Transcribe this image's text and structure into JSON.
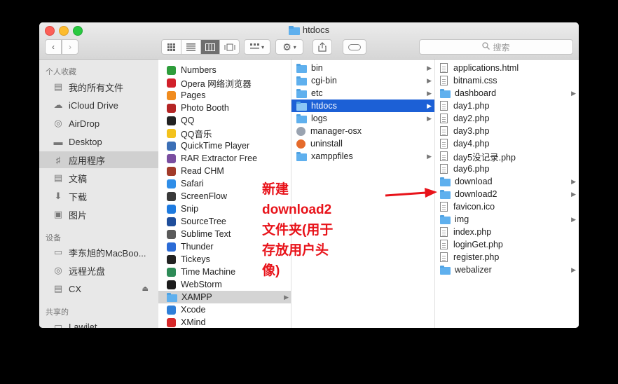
{
  "window": {
    "title": "htdocs",
    "search_placeholder": "搜索"
  },
  "sidebar": {
    "favorites_header": "个人收藏",
    "favorites": [
      {
        "label": "我的所有文件",
        "icon": "all-files-icon"
      },
      {
        "label": "iCloud Drive",
        "icon": "cloud-icon"
      },
      {
        "label": "AirDrop",
        "icon": "airdrop-icon"
      },
      {
        "label": "Desktop",
        "icon": "desktop-icon"
      },
      {
        "label": "应用程序",
        "icon": "applications-icon",
        "selected": true
      },
      {
        "label": "文稿",
        "icon": "documents-icon"
      },
      {
        "label": "下载",
        "icon": "downloads-icon"
      },
      {
        "label": "图片",
        "icon": "pictures-icon"
      }
    ],
    "devices_header": "设备",
    "devices": [
      {
        "label": "李东旭的MacBoo...",
        "icon": "laptop-icon"
      },
      {
        "label": "远程光盘",
        "icon": "disc-icon"
      },
      {
        "label": "CX",
        "icon": "drive-icon"
      }
    ],
    "shared_header": "共享的",
    "shared": [
      {
        "label": "Lawilet",
        "icon": "network-icon"
      }
    ]
  },
  "column1": [
    {
      "label": "Numbers",
      "color": "#2e9d3b"
    },
    {
      "label": "Opera 网络浏览器",
      "color": "#d1202a"
    },
    {
      "label": "Pages",
      "color": "#f08b1e"
    },
    {
      "label": "Photo Booth",
      "color": "#b42525"
    },
    {
      "label": "QQ",
      "color": "#222222"
    },
    {
      "label": "QQ音乐",
      "color": "#f3c21c"
    },
    {
      "label": "QuickTime Player",
      "color": "#3b6fb6"
    },
    {
      "label": "RAR Extractor Free",
      "color": "#7a4ea0"
    },
    {
      "label": "Read CHM",
      "color": "#a23b2a"
    },
    {
      "label": "Safari",
      "color": "#2f8ee8"
    },
    {
      "label": "ScreenFlow",
      "color": "#3a3a3a"
    },
    {
      "label": "Snip",
      "color": "#1e7be0"
    },
    {
      "label": "SourceTree",
      "color": "#1f4e9b"
    },
    {
      "label": "Sublime Text",
      "color": "#5a5a5a"
    },
    {
      "label": "Thunder",
      "color": "#2b6bd6"
    },
    {
      "label": "Tickeys",
      "color": "#222222"
    },
    {
      "label": "Time Machine",
      "color": "#2e8b57"
    },
    {
      "label": "WebStorm",
      "color": "#1c1c1c"
    },
    {
      "label": "XAMPP",
      "color": "#5fb0ee",
      "folder": true,
      "selected": true
    },
    {
      "label": "Xcode",
      "color": "#2f7fd8"
    },
    {
      "label": "XMind",
      "color": "#d6282a"
    }
  ],
  "column2": [
    {
      "label": "bin",
      "type": "folder",
      "chevron": true
    },
    {
      "label": "cgi-bin",
      "type": "folder",
      "chevron": true
    },
    {
      "label": "etc",
      "type": "folder",
      "chevron": true
    },
    {
      "label": "htdocs",
      "type": "folder",
      "chevron": true,
      "selected": true
    },
    {
      "label": "logs",
      "type": "folder",
      "chevron": true
    },
    {
      "label": "manager-osx",
      "type": "app"
    },
    {
      "label": "uninstall",
      "type": "app"
    },
    {
      "label": "xamppfiles",
      "type": "folder",
      "chevron": true
    }
  ],
  "column3": [
    {
      "label": "applications.html",
      "type": "file"
    },
    {
      "label": "bitnami.css",
      "type": "file"
    },
    {
      "label": "dashboard",
      "type": "folder",
      "chevron": true
    },
    {
      "label": "day1.php",
      "type": "file"
    },
    {
      "label": "day2.php",
      "type": "file"
    },
    {
      "label": "day3.php",
      "type": "file"
    },
    {
      "label": "day4.php",
      "type": "file"
    },
    {
      "label": "day5没记录.php",
      "type": "file"
    },
    {
      "label": "day6.php",
      "type": "file"
    },
    {
      "label": "download",
      "type": "folder",
      "chevron": true
    },
    {
      "label": "download2",
      "type": "folder",
      "chevron": true
    },
    {
      "label": "favicon.ico",
      "type": "file"
    },
    {
      "label": "img",
      "type": "folder",
      "chevron": true
    },
    {
      "label": "index.php",
      "type": "file"
    },
    {
      "label": "loginGet.php",
      "type": "file"
    },
    {
      "label": "register.php",
      "type": "file"
    },
    {
      "label": "webalizer",
      "type": "folder",
      "chevron": true
    }
  ],
  "annotation": {
    "lines": [
      "新建",
      "download2",
      "文件夹(用于",
      "存放用户头",
      "像)"
    ],
    "color": "#e8131a"
  }
}
